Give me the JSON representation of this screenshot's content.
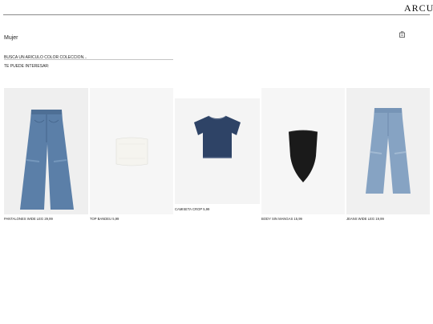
{
  "header": {
    "brand": "ARCUX",
    "bag_icon": "shopping-bag-icon"
  },
  "page": {
    "section_title": "Mujer",
    "search": {
      "placeholder": "BUSCA UN ARÍCULO COLOR COLECCIÓN...",
      "value": ""
    },
    "suggest_label": "TE PUEDE INTERESAR:"
  },
  "products": [
    {
      "name": "PANTALONES WIDE LEG",
      "price": "29,99",
      "caption": "PANTALONES WIDE LEG 29,99",
      "icon": "wide-leg-jeans-image",
      "color": "#5b7fa8"
    },
    {
      "name": "TOP BANDEU",
      "price": "5,99",
      "caption": "TOP BANDEU 5,99",
      "icon": "bandeau-top-image",
      "color": "#f5f4ef"
    },
    {
      "name": "CAMISETA CROP",
      "price": "5,99",
      "caption": "CAMISETA CROP 5,99",
      "icon": "crop-tshirt-image",
      "color": "#2e4366"
    },
    {
      "name": "BODY SIN MANGAS",
      "price": "15,99",
      "caption": "BODY SIN MANGAS 15,99",
      "icon": "strapless-bodysuit-image",
      "color": "#1a1a1a"
    },
    {
      "name": "JEANS WIDE LEG",
      "price": "19,99",
      "caption": "JEANS WIDE LEG 19,99",
      "icon": "wide-leg-jeans-image",
      "color": "#86a3c3"
    }
  ]
}
